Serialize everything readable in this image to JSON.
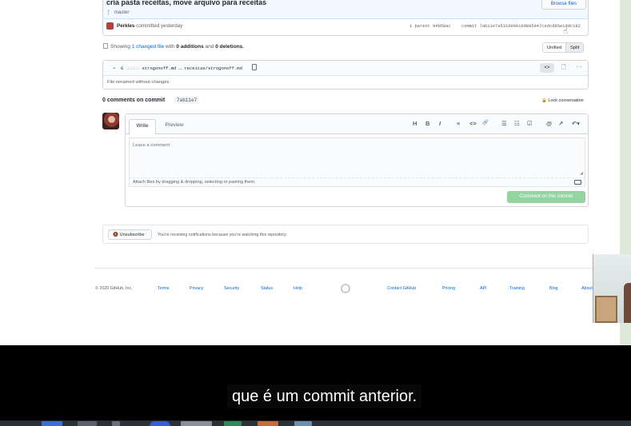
{
  "commit": {
    "title": "cria pasta receitas, move arquivo para receitas",
    "branch": "master",
    "browse_files": "Browse files",
    "author": "Perkles",
    "committed": "committed yesterday",
    "parent_label": "1 parent 94958ac",
    "commit_label": "commit 7ab11e7a531680916d895947cedcd85e1ddc182"
  },
  "diff_summary": {
    "showing": "Showing",
    "changed_files": "1 changed file",
    "with": "with",
    "additions": "0 additions",
    "and": "and",
    "deletions": "0 deletions.",
    "unified": "Unified",
    "split": "Split"
  },
  "file": {
    "count": "0",
    "hidden": "□□□□□",
    "path": "strogonoff.md → receitas/strogonoff.md",
    "code_toggle": "<>",
    "renamed_note": "File renamed without changes."
  },
  "comments": {
    "title": "0 comments on commit",
    "sha": "7ab11e7",
    "lock": "Lock conversation"
  },
  "comment_form": {
    "write_tab": "Write",
    "preview_tab": "Preview",
    "toolbar": [
      "H",
      "B",
      "I",
      "≡",
      "<>",
      "🔗",
      "☰",
      "☷",
      "☑",
      "@",
      "↗",
      "↶▾"
    ],
    "placeholder": "Leave a comment",
    "attach": "Attach files by dragging & dropping, selecting or pasting them.",
    "submit": "Comment on this commit"
  },
  "notifications": {
    "unsubscribe": "Unsubscribe",
    "text": "You're receiving notifications because you're watching this repository."
  },
  "footer": {
    "copyright": "© 2020 GitHub, Inc.",
    "left_links": [
      "Terms",
      "Privacy",
      "Security",
      "Status",
      "Help"
    ],
    "right_links": [
      "Contact GitHub",
      "Pricing",
      "API",
      "Training",
      "Blog",
      "About"
    ]
  },
  "subtitle": "que é um commit anterior.",
  "colors": {
    "link": "#0366d6",
    "submit_green": "#94d3a2",
    "commit_header_bg": "#f1f8ff"
  }
}
